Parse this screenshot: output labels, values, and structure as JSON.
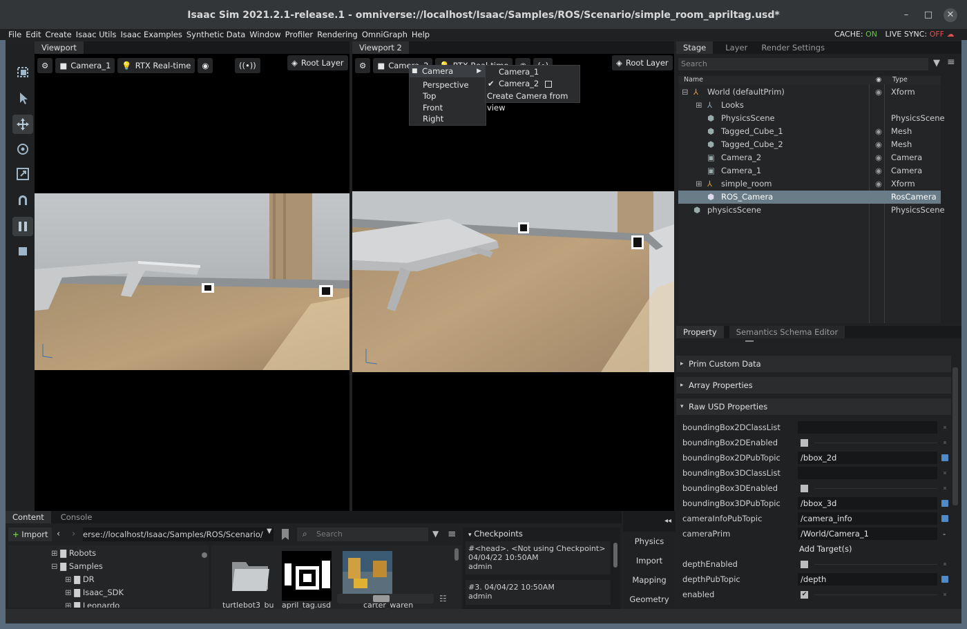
{
  "window": {
    "title": "Isaac Sim 2021.2.1-release.1 - omniverse://localhost/Isaac/Samples/ROS/Scenario/simple_room_apriltag.usd*",
    "min": "–",
    "max": "□",
    "close": "✕"
  },
  "menu": [
    "File",
    "Edit",
    "Create",
    "Isaac Utils",
    "Isaac Examples",
    "Synthetic Data",
    "Window",
    "Profiler",
    "Rendering",
    "OmniGraph",
    "Help"
  ],
  "status": {
    "cache_label": "CACHE:",
    "cache_value": "ON",
    "sync_label": "LIVE SYNC:",
    "sync_value": "OFF"
  },
  "colors": {
    "on": "#6cc24a",
    "off": "#e05050",
    "accent": "#4f8bc9",
    "selected_row": "#6a7c88"
  },
  "viewport1": {
    "tab": "Viewport",
    "camera": "Camera_1",
    "render": "RTX Real-time",
    "layer": "Root Layer",
    "broadcast": "((•))"
  },
  "viewport2": {
    "tab": "Viewport 2",
    "camera": "Camera_2",
    "render": "RTX Real-time",
    "layer": "Root Layer",
    "broadcast": "(•)"
  },
  "camera_menu": {
    "header": "Camera",
    "items": [
      "Perspective",
      "Top",
      "Front",
      "Right"
    ],
    "submenu": [
      "Camera_1",
      "Camera_2",
      "Create Camera from view"
    ],
    "checked": "✔"
  },
  "stage": {
    "tabs": [
      "Stage",
      "Layer",
      "Render Settings"
    ],
    "search_placeholder": "Search",
    "col_name": "Name",
    "col_type": "Type",
    "rows": [
      {
        "name": "World (defaultPrim)",
        "type": "Xform",
        "expander": "⊟",
        "eye": true
      },
      {
        "name": "Looks",
        "type": "",
        "expander": "⊞",
        "eye": false
      },
      {
        "name": "PhysicsScene",
        "type": "PhysicsScene",
        "expander": "",
        "eye": false
      },
      {
        "name": "Tagged_Cube_1",
        "type": "Mesh",
        "expander": "",
        "eye": true
      },
      {
        "name": "Tagged_Cube_2",
        "type": "Mesh",
        "expander": "",
        "eye": true
      },
      {
        "name": "Camera_2",
        "type": "Camera",
        "expander": "",
        "eye": true
      },
      {
        "name": "Camera_1",
        "type": "Camera",
        "expander": "",
        "eye": true
      },
      {
        "name": "simple_room",
        "type": "Xform",
        "expander": "⊞",
        "eye": true
      },
      {
        "name": "ROS_Camera",
        "type": "RosCamera",
        "expander": "",
        "eye": false
      },
      {
        "name": "physicsScene",
        "type": "PhysicsScene",
        "expander": "",
        "eye": false
      }
    ]
  },
  "property": {
    "tabs": [
      "Property",
      "Semantics Schema Editor"
    ],
    "sections": [
      "Prim Custom Data",
      "Array Properties",
      "Raw USD Properties"
    ],
    "rows": [
      {
        "label": "boundingBox2DClassList",
        "kind": "field",
        "value": ""
      },
      {
        "label": "boundingBox2DEnabled",
        "kind": "check",
        "value": ""
      },
      {
        "label": "boundingBox2DPubTopic",
        "kind": "field",
        "value": "/bbox_2d"
      },
      {
        "label": "boundingBox3DClassList",
        "kind": "field",
        "value": ""
      },
      {
        "label": "boundingBox3DEnabled",
        "kind": "check",
        "value": ""
      },
      {
        "label": "boundingBox3DPubTopic",
        "kind": "field",
        "value": "/bbox_3d"
      },
      {
        "label": "cameraInfoPubTopic",
        "kind": "field",
        "value": "/camera_info"
      },
      {
        "label": "cameraPrim",
        "kind": "field",
        "value": "/World/Camera_1"
      },
      {
        "label": "",
        "kind": "add",
        "value": "Add Target(s)"
      },
      {
        "label": "depthEnabled",
        "kind": "check",
        "value": ""
      },
      {
        "label": "depthPubTopic",
        "kind": "field",
        "value": "/depth"
      },
      {
        "label": "enabled",
        "kind": "checked",
        "value": "✔"
      }
    ]
  },
  "content": {
    "tabs": [
      "Content",
      "Console"
    ],
    "import": "Import",
    "path": "erse://localhost/Isaac/Samples/ROS/Scenario/",
    "search_placeholder": "Search",
    "tree": [
      {
        "label": "Robots",
        "expander": "⊞"
      },
      {
        "label": "Samples",
        "expander": "⊟"
      },
      {
        "label": "DR",
        "expander": "⊞"
      },
      {
        "label": "Isaac_SDK",
        "expander": "⊞"
      },
      {
        "label": "Leonardo",
        "expander": "⊞"
      }
    ],
    "files": [
      "turtlebot3_bu",
      "april_tag.usd",
      "carter_wareh"
    ],
    "checkpoints_title": "Checkpoints",
    "checkpoints": [
      {
        "head": "#<head>.  <Not using Checkpoint>",
        "date": "04/04/22 10:50AM",
        "user": "admin"
      },
      {
        "head": "#3.   04/04/22 10:50AM",
        "date": "",
        "user": "admin"
      }
    ]
  },
  "side_panel": {
    "collapse": "◂◂",
    "buttons": [
      "Physics",
      "Import",
      "Mapping",
      "Geometry"
    ]
  }
}
